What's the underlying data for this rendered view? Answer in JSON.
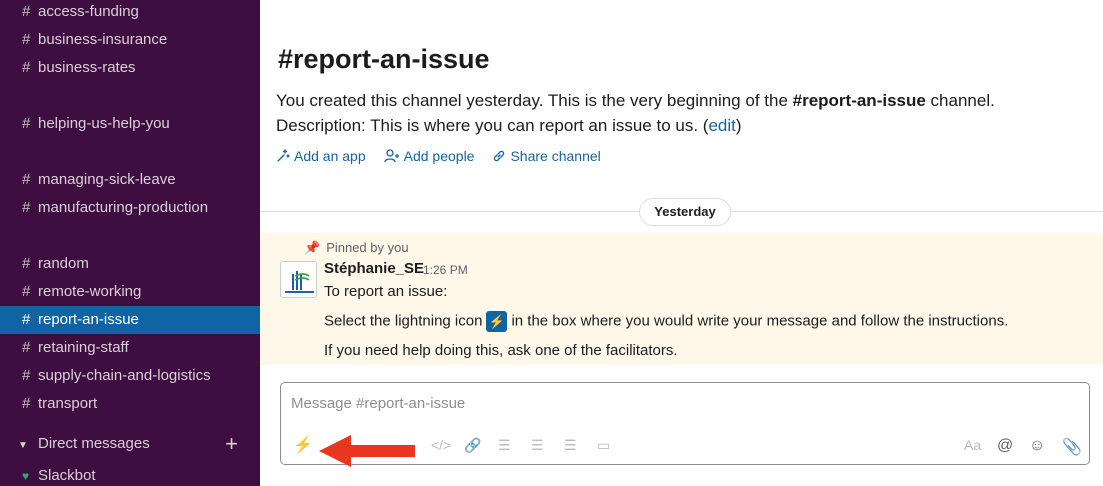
{
  "sidebar": {
    "channels": [
      {
        "label": "access-funding"
      },
      {
        "label": "business-insurance"
      },
      {
        "label": "business-rates"
      },
      {
        "label": "helping-us-help-you"
      },
      {
        "label": "managing-sick-leave"
      },
      {
        "label": "manufacturing-production"
      },
      {
        "label": "random"
      },
      {
        "label": "remote-working"
      },
      {
        "label": "report-an-issue"
      },
      {
        "label": "retaining-staff"
      },
      {
        "label": "supply-chain-and-logistics"
      },
      {
        "label": "transport"
      }
    ],
    "hash": "#",
    "dm_header": "Direct messages",
    "dm_plus": "+",
    "dm_items": [
      {
        "label": "Slackbot"
      }
    ]
  },
  "channel": {
    "title": "#report-an-issue",
    "intro_prefix": "You created this channel yesterday. This is the very beginning of the ",
    "intro_channel": "#report-an-issue",
    "intro_suffix": " channel.",
    "description_prefix": "Description: This is where you can report an issue to us. (",
    "description_edit": "edit",
    "description_suffix": ")",
    "actions": {
      "add_app": "Add an app",
      "add_people": "Add people",
      "share_channel": "Share channel"
    }
  },
  "divider_label": "Yesterday",
  "message": {
    "pinned_label": "Pinned by you",
    "author": "Stéphanie_SE",
    "time": "1:26 PM",
    "line1": "To report an issue:",
    "line2_prefix": "Select the lightning icon",
    "line2_suffix": "in the box where you would write your message and follow the instructions.",
    "line3": "If you need help doing this, ask one of the facilitators."
  },
  "composer": {
    "placeholder": "Message #report-an-issue",
    "format_label": "Aa"
  },
  "colors": {
    "sidebar_bg": "#3f0e40",
    "active_channel": "#1164a3",
    "link": "#1264a3",
    "pinned_bg": "#fdf8e9",
    "arrow": "#e8361f"
  }
}
